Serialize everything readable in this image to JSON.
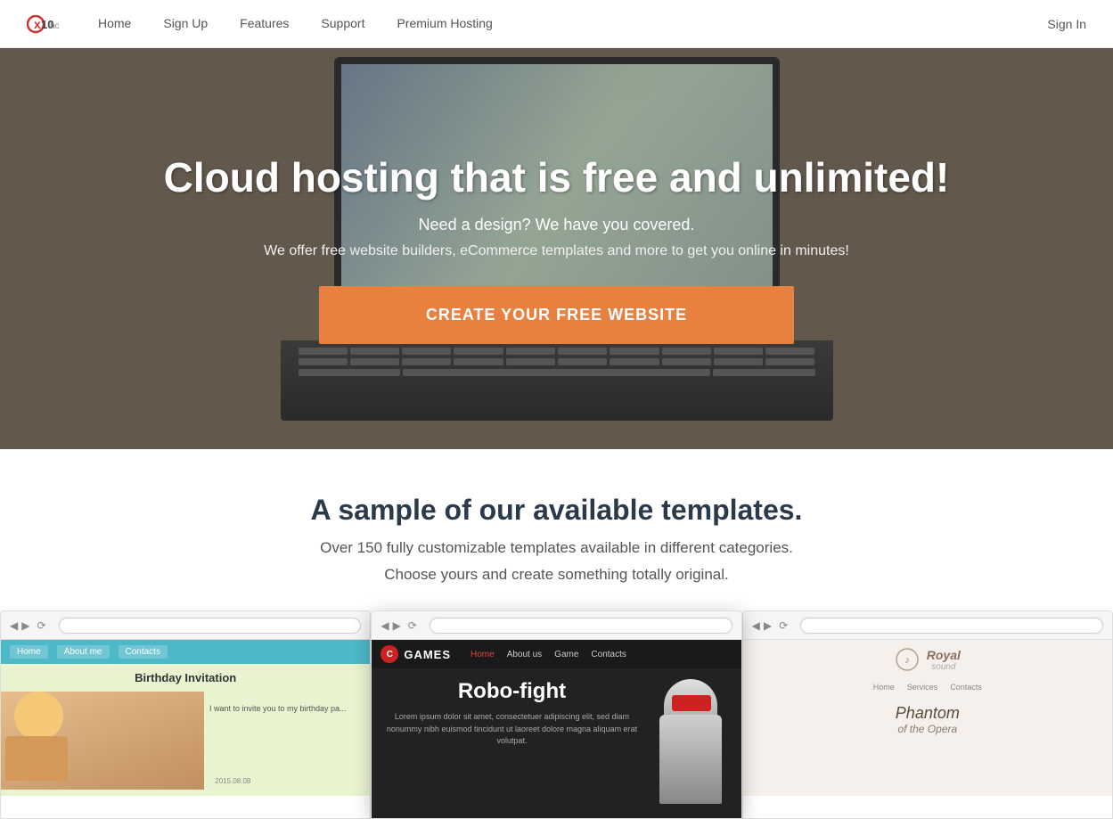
{
  "navbar": {
    "logo_text": "10hosting",
    "nav_links": [
      {
        "label": "Home",
        "href": "#"
      },
      {
        "label": "Sign Up",
        "href": "#"
      },
      {
        "label": "Features",
        "href": "#"
      },
      {
        "label": "Support",
        "href": "#"
      },
      {
        "label": "Premium Hosting",
        "href": "#"
      }
    ],
    "signin_label": "Sign In"
  },
  "hero": {
    "title": "Cloud hosting that is free and unlimited!",
    "subtitle": "Need a design? We have you covered.",
    "description": "We offer free website builders, eCommerce templates and more to get you online in minutes!",
    "cta_label": "CREATE YOUR FREE WEBSITE"
  },
  "templates": {
    "title": "A sample of our available templates.",
    "subtitle": "Over 150 fully customizable templates available in different categories.",
    "tagline": "Choose yours and create something totally original.",
    "previews": [
      {
        "id": "birthday",
        "title": "Birthday Invitation",
        "content_text": "I want to invite you to my birthday pa..."
      },
      {
        "id": "games",
        "logo": "C",
        "brand": "GAMES",
        "nav": [
          "Home",
          "About us",
          "Game",
          "Contacts"
        ],
        "hero_title": "Robo-fight",
        "hero_desc": "Lorem ipsum dolor sit amet, consectetuer adipiscing elit, sed diam nonummy nibh euismod tincidunt ut laoreet dolore magna aliquam erat volutpat."
      },
      {
        "id": "royal",
        "nav": [
          "Home",
          "Services",
          "Contacts"
        ],
        "logo_line1": "Royal",
        "logo_line2": "sound",
        "title": "Phantom",
        "subtitle": "of the Opera"
      }
    ]
  },
  "colors": {
    "cta_orange": "#e88040",
    "nav_teal": "#4db8c8",
    "games_red": "#cc2222",
    "hero_bg": "#7a7060"
  }
}
